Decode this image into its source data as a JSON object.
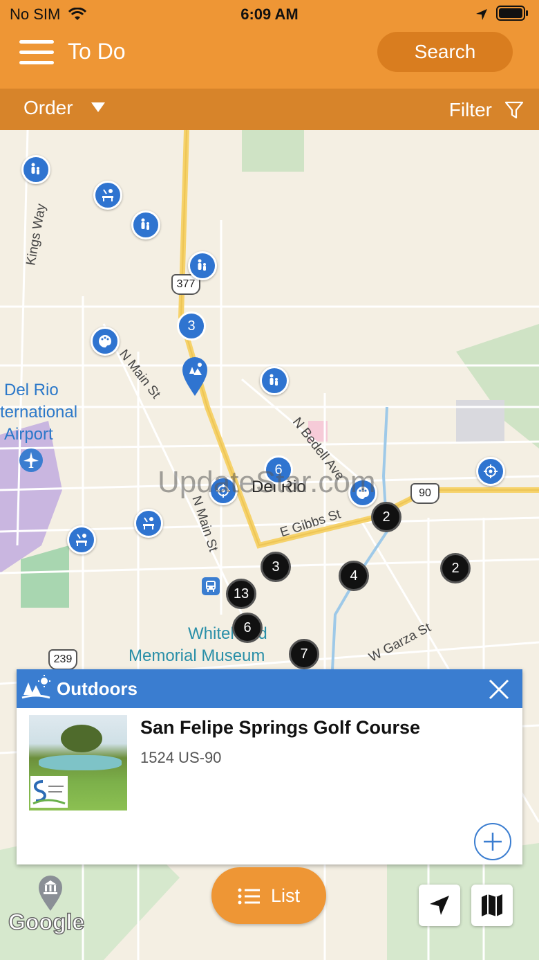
{
  "status": {
    "carrier": "No SIM",
    "time": "6:09 AM"
  },
  "header": {
    "title": "To Do",
    "search_label": "Search"
  },
  "subbar": {
    "order_label": "Order",
    "filter_label": "Filter"
  },
  "map": {
    "labels": {
      "kings_way": "Kings Way",
      "n_main_st_1": "N Main St",
      "n_main_st_2": "N Main St",
      "n_bedell_ave": "N Bedell Ave",
      "e_gibbs_st": "E Gibbs St",
      "w_garza_st": "W Garza St",
      "del_rio": "Del Rio",
      "airport_1": "Del Rio",
      "airport_2": "ternational",
      "airport_3": "Airport",
      "museum_1": "Whitehead",
      "museum_2": "Memorial Museum",
      "route_377": "377",
      "route_90": "90",
      "route_239": "239"
    },
    "blue_clusters": [
      "3",
      "6"
    ],
    "black_clusters": [
      "2",
      "3",
      "4",
      "2",
      "13",
      "6",
      "7"
    ],
    "watermark": "UpdateStar.com",
    "google": "Google"
  },
  "card": {
    "category": "Outdoors",
    "name": "San Felipe Springs Golf Course",
    "address": "1524 US-90",
    "image_logo_text": "SAN FELIPE SPRINGS"
  },
  "list_button": {
    "label": "List"
  },
  "colors": {
    "primary": "#ee9635",
    "secondary": "#d7842a",
    "accent_blue": "#3a7dd0"
  }
}
